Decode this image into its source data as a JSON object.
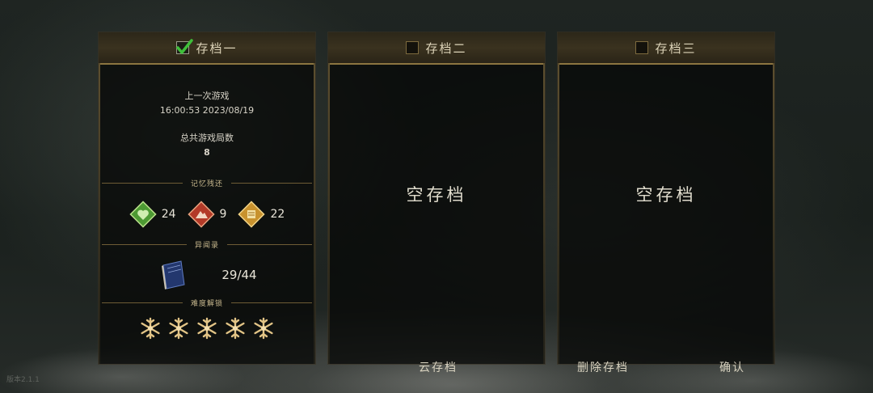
{
  "slots": [
    {
      "title": "存档一",
      "checked": true,
      "last_play_label": "上一次游戏",
      "last_play_time": "16:00:53 2023/08/19",
      "total_label": "总共游戏局数",
      "total_count": "8",
      "memory_title": "记忆残还",
      "memory_items": [
        {
          "icon": "green-heart-gem-icon",
          "value": "24",
          "color": "#5fae3e"
        },
        {
          "icon": "red-mountain-gem-icon",
          "value": "9",
          "color": "#c2432f"
        },
        {
          "icon": "gold-scroll-gem-icon",
          "value": "22",
          "color": "#d6a23a"
        }
      ],
      "record_title": "异闻录",
      "record_count": "29/44",
      "difficulty_title": "难度解锁",
      "difficulty_unlocked": 5
    },
    {
      "title": "存档二",
      "checked": false,
      "empty_label": "空存档"
    },
    {
      "title": "存档三",
      "checked": false,
      "empty_label": "空存档"
    }
  ],
  "buttons": {
    "cloud": "云存档",
    "delete": "删除存档",
    "confirm": "确认"
  },
  "version": "版本2.1.1"
}
